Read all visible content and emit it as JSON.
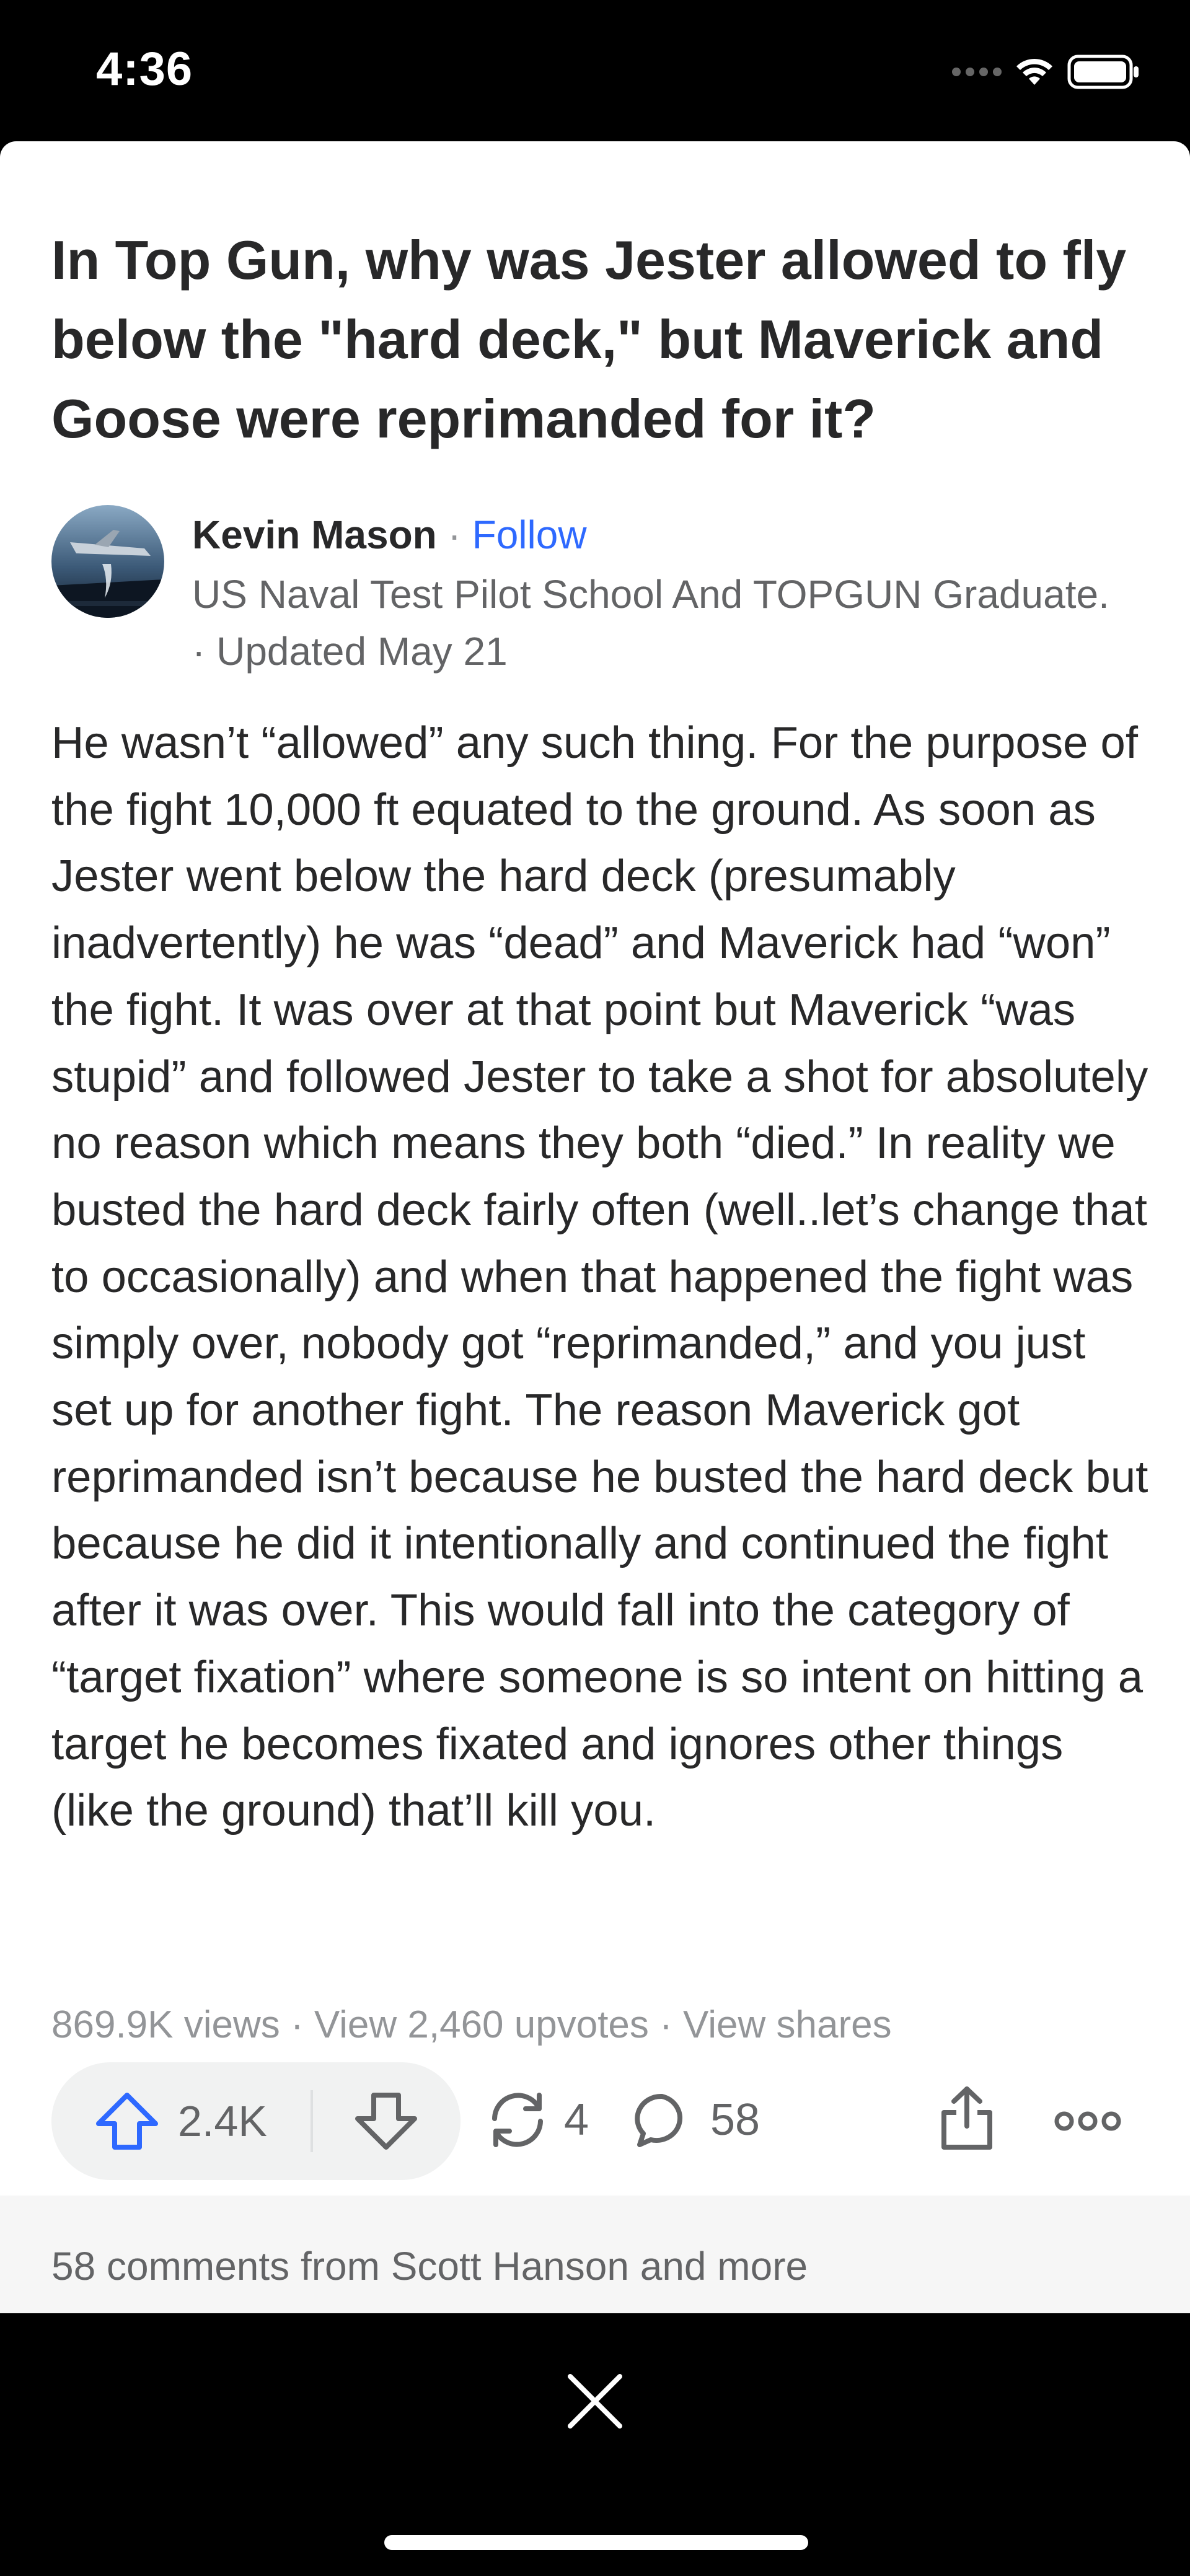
{
  "status_bar": {
    "time": "4:36"
  },
  "question": {
    "title": "In Top Gun, why was Jester allowed to fly below the \"hard deck,\" but Maverick and Goose were reprimanded for it?"
  },
  "author": {
    "name": "Kevin Mason",
    "separator": "·",
    "follow_label": "Follow",
    "credential": "US Naval Test Pilot School And TOPGUN Graduate. · Updated May 21"
  },
  "answer": {
    "body": "He wasn’t “allowed” any such thing. For the purpose of the fight 10,000 ft equated to the ground. As soon as Jester went below the hard deck (presumably inadvertently) he was “dead” and Maverick had “won” the fight. It was over at that point but Maverick “was stupid” and followed Jester to take a shot for absolutely no reason which means they both “died.” In reality we busted the hard deck fairly often (well..let’s change that to occasionally) and when that happened the fight was simply over, nobody got “reprimanded,” and you just set up for another fight. The reason Maverick got reprimanded isn’t because he busted the hard deck but because he did it intentionally and continued the fight after it was over. This would fall into the category of “target fixation” where someone is so intent on hitting a target he becomes fixated and ignores other things (like the ground) that’ll kill you."
  },
  "stats": {
    "views": "869.9K views",
    "separator": "·",
    "upvotes_link": "View 2,460 upvotes",
    "shares_link": "View shares"
  },
  "actions": {
    "upvote_count": "2.4K",
    "share_count": "4",
    "comment_count": "58",
    "icons": {
      "upvote": "arrow-up-icon",
      "downvote": "arrow-down-icon",
      "reshare": "reshare-icon",
      "comment": "speech-bubble-icon",
      "export": "share-export-icon",
      "more": "more-dots-icon",
      "close": "close-icon"
    },
    "upvote_color": "#2e69ff"
  },
  "comments": {
    "preview": "58 comments from Scott Hanson and more"
  }
}
